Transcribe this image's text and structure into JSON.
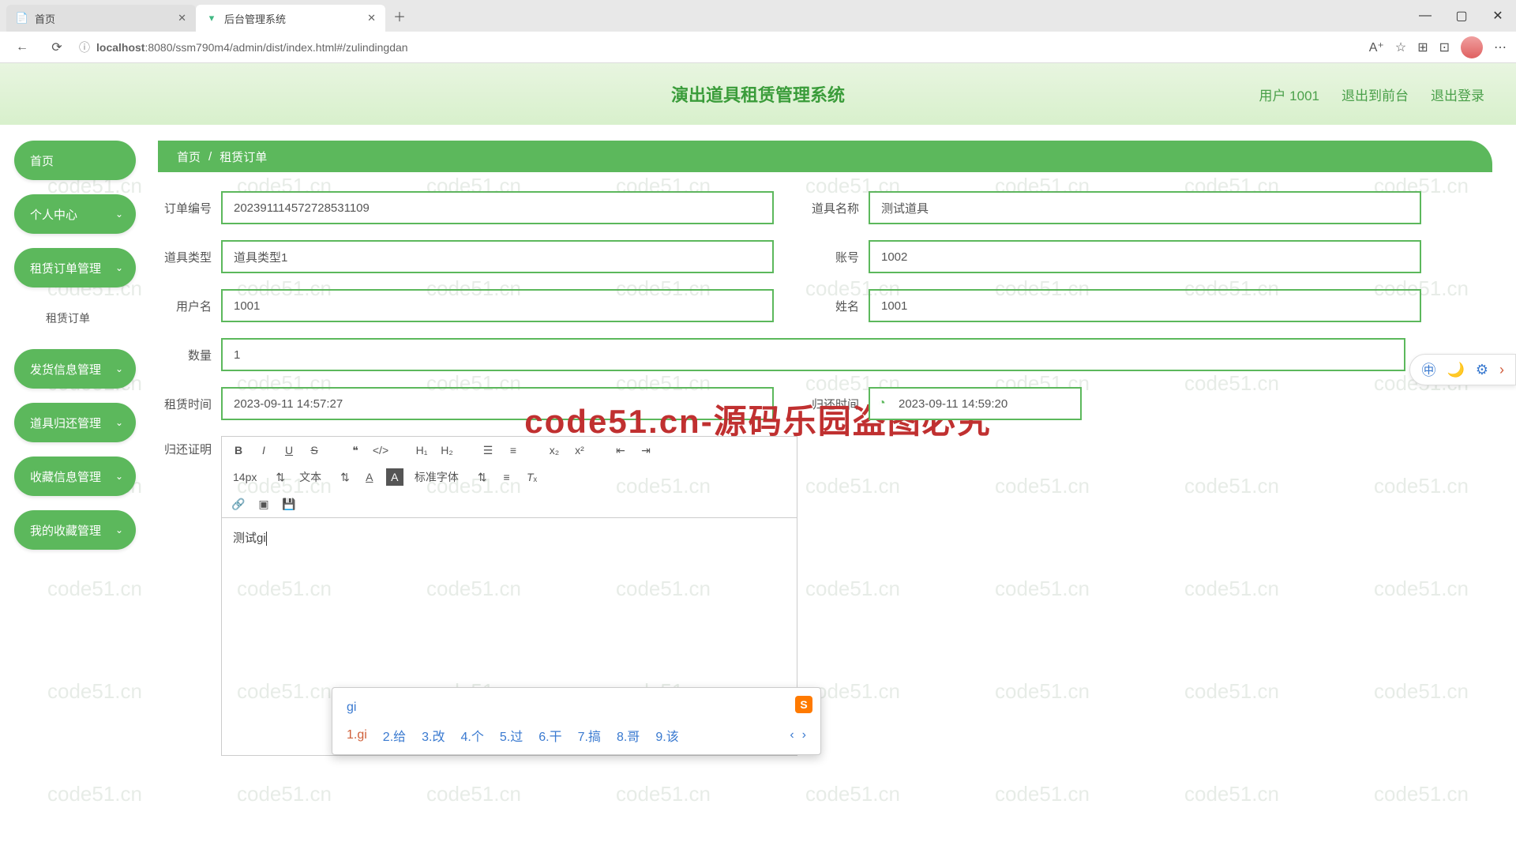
{
  "browser": {
    "tabs": [
      {
        "title": "首页",
        "active": false
      },
      {
        "title": "后台管理系统",
        "active": true
      }
    ],
    "url_host": "localhost",
    "url_path": ":8080/ssm790m4/admin/dist/index.html#/zulindingdan"
  },
  "header": {
    "title": "演出道具租赁管理系统",
    "user": "用户 1001",
    "to_front": "退出到前台",
    "logout": "退出登录"
  },
  "sidebar": {
    "items": [
      {
        "label": "首页",
        "expandable": false
      },
      {
        "label": "个人中心",
        "expandable": true
      },
      {
        "label": "租赁订单管理",
        "expandable": true,
        "open": true,
        "children": [
          "租赁订单"
        ]
      },
      {
        "label": "发货信息管理",
        "expandable": true
      },
      {
        "label": "道具归还管理",
        "expandable": true
      },
      {
        "label": "收藏信息管理",
        "expandable": true
      },
      {
        "label": "我的收藏管理",
        "expandable": true
      }
    ]
  },
  "breadcrumb": {
    "home": "首页",
    "current": "租赁订单"
  },
  "form": {
    "order_no_label": "订单编号",
    "order_no": "202391114572728531109",
    "prop_name_label": "道具名称",
    "prop_name": "测试道具",
    "prop_type_label": "道具类型",
    "prop_type": "道具类型1",
    "account_label": "账号",
    "account": "1002",
    "username_label": "用户名",
    "username": "1001",
    "realname_label": "姓名",
    "realname": "1001",
    "qty_label": "数量",
    "qty": "1",
    "rent_time_label": "租赁时间",
    "rent_time": "2023-09-11 14:57:27",
    "return_time_label": "归还时间",
    "return_time": "2023-09-11 14:59:20",
    "proof_label": "归还证明"
  },
  "editor": {
    "font_size": "14px",
    "block_type": "文本",
    "font_family": "标准字体",
    "content": "测试gi"
  },
  "ime": {
    "input": "gi",
    "candidates": [
      "1.gi",
      "2.给",
      "3.改",
      "4.个",
      "5.过",
      "6.干",
      "7.搞",
      "8.哥",
      "9.该"
    ],
    "logo": "S"
  },
  "watermark": "code51.cn",
  "big_watermark": "code51.cn-源码乐园盗图必究"
}
